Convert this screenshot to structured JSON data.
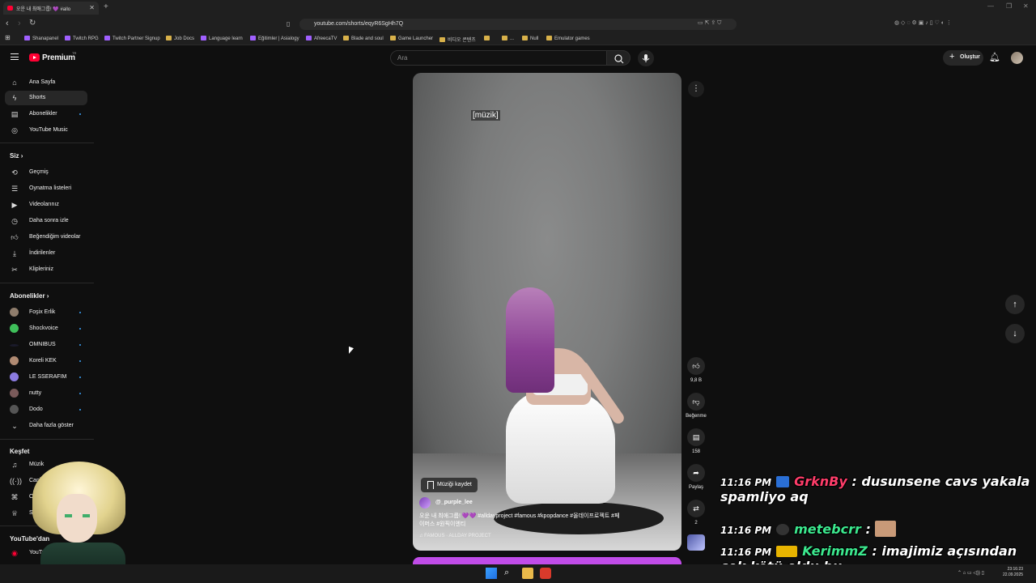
{
  "browser": {
    "tab_title": "오운 내 최애그룹! 💜 #allo",
    "url": "youtube.com/shorts/eqyR6SgHh7Q",
    "bookmarks": [
      "Shanapanel",
      "Twitch RPG",
      "Twitch Partner Signup",
      "Job Docs",
      "Language learn",
      "Eğitimler | Asialogy",
      "AfreecaTV",
      "Blade and soul",
      "Game Launcher",
      "비디오 콘텐츠",
      "",
      "...",
      "Null",
      "Emulator games"
    ]
  },
  "header": {
    "brand": "Premium",
    "region": "TR",
    "search_placeholder": "Ara",
    "create_label": "Oluştur"
  },
  "sidebar": {
    "main": [
      "Ana Sayfa",
      "Shorts",
      "Abonelikler",
      "YouTube Music"
    ],
    "you_title": "Siz",
    "you": [
      "Geçmiş",
      "Oynatma listeleri",
      "Videolarınız",
      "Daha sonra izle",
      "Beğendiğim videolar",
      "İndirilenler",
      "Klipleriniz"
    ],
    "subs_title": "Abonelikler",
    "subs": [
      "Foşix Erlik",
      "Shockvoice",
      "OMNIBUS",
      "Koreli KEK",
      "LE SSERAFIM",
      "nutty",
      "Dodo"
    ],
    "show_more": "Daha fazla göster",
    "explore_title": "Keşfet",
    "explore": [
      "Müzik",
      "Canlı",
      "Oyun",
      "Spor"
    ],
    "from_youtube_title": "YouTube'dan",
    "from_youtube": [
      "YouTube"
    ]
  },
  "short": {
    "caption": "[müzik]",
    "save_music": "Müziği kaydet",
    "channel": "@_purple_lee",
    "description": "오운 내 최애그룹! 💜💜 #alldayproject #famous #kpopdance #올데이프로젝트 #페이머스 #원픽이엔티",
    "music": "♫ FAMOUS · ALLDAY PROJECT"
  },
  "actions": {
    "likes": "9,8 B",
    "dislike_label": "Beğenme",
    "comments": "158",
    "share_label": "Paylaş",
    "remix_count": "2"
  },
  "chat": [
    {
      "time": "11:16 PM",
      "user": "GrknBy",
      "user_color": "#ff3d6a",
      "message": ": dusunsene cavs yakala spamliyo aq"
    },
    {
      "time": "11:16 PM",
      "user": "metebcrr",
      "user_color": "#3ce88e",
      "message": ":"
    },
    {
      "time": "11:16 PM",
      "user": "KerimmZ",
      "user_color": "#3ce88e",
      "message": ": imajimiz açısından çok kötü oldu bu"
    }
  ],
  "taskbar": {
    "time": "23:16:23",
    "date": "22.09.2025"
  }
}
